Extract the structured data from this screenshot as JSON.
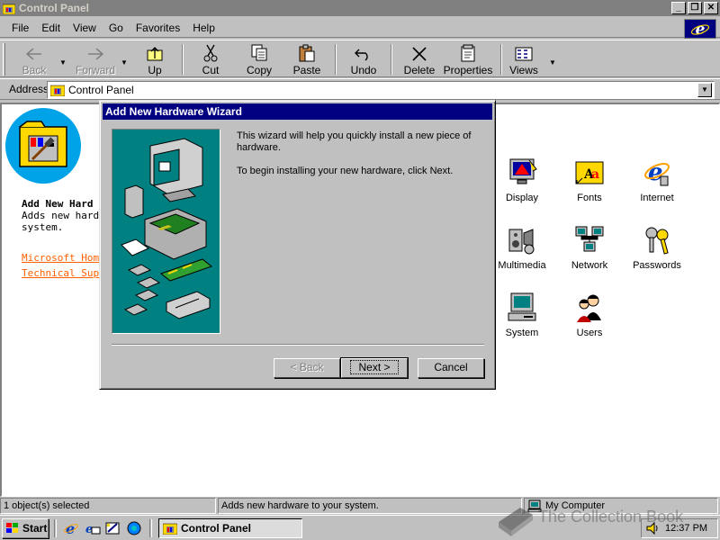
{
  "window": {
    "title": "Control Panel"
  },
  "caption_buttons": {
    "minimize": "_",
    "restore": "❐",
    "close": "✕"
  },
  "menu": {
    "items": [
      {
        "label": "File",
        "underline": "F"
      },
      {
        "label": "Edit",
        "underline": "E"
      },
      {
        "label": "View",
        "underline": "V"
      },
      {
        "label": "Go",
        "underline": "G"
      },
      {
        "label": "Favorites",
        "underline": "a"
      },
      {
        "label": "Help",
        "underline": "H"
      }
    ]
  },
  "toolbar": {
    "back": "Back",
    "forward": "Forward",
    "up": "Up",
    "cut": "Cut",
    "copy": "Copy",
    "paste": "Paste",
    "undo": "Undo",
    "delete": "Delete",
    "properties": "Properties",
    "views": "Views"
  },
  "address": {
    "label": "Address",
    "value": "Control Panel"
  },
  "info_panel": {
    "title": "Add New Hard",
    "description": "Adds new hardw system.",
    "link1": "Microsoft Home",
    "link2": "Technical Suppo"
  },
  "icons": [
    {
      "label": "Display",
      "icon": "display-icon"
    },
    {
      "label": "Fonts",
      "icon": "fonts-icon"
    },
    {
      "label": "Internet",
      "icon": "internet-icon"
    },
    {
      "label": "Multimedia",
      "icon": "multimedia-icon"
    },
    {
      "label": "Network",
      "icon": "network-icon"
    },
    {
      "label": "Passwords",
      "icon": "passwords-icon"
    },
    {
      "label": "System",
      "icon": "system-icon"
    },
    {
      "label": "Users",
      "icon": "users-icon"
    }
  ],
  "dialog": {
    "title": "Add New Hardware Wizard",
    "text1": "This wizard will help you quickly install a new piece of hardware.",
    "text2": "To begin installing your new hardware, click Next.",
    "back_button": "< Back",
    "next_button": "Next >",
    "cancel_button": "Cancel"
  },
  "statusbar": {
    "selection": "1 object(s) selected",
    "description": "Adds new hardware to your system.",
    "zone": "My Computer"
  },
  "taskbar": {
    "start": "Start",
    "task": "Control Panel",
    "time": "12:37 PM"
  },
  "watermark": {
    "text": "The Collection Book"
  },
  "colors": {
    "title_active": "#000080",
    "title_inactive": "#808080",
    "face": "#c0c0c0",
    "link": "#ff6000",
    "teal": "#008080"
  }
}
